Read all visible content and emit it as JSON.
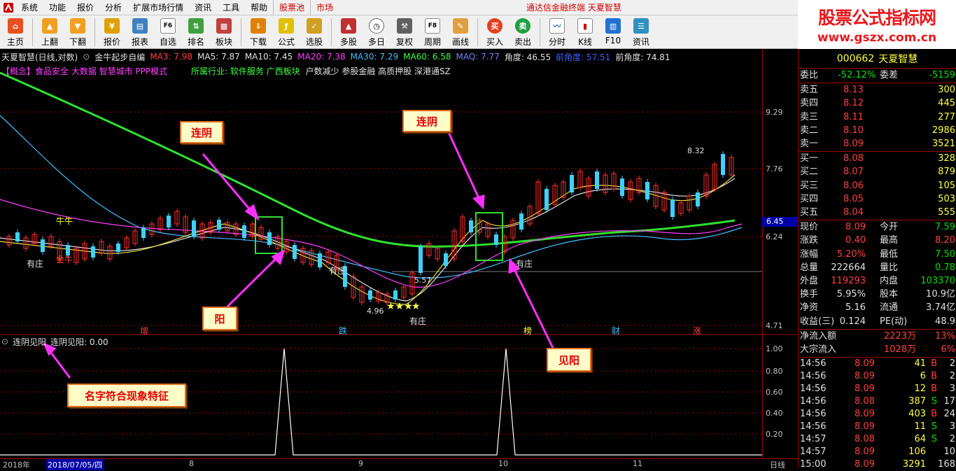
{
  "menubar": {
    "items": [
      "系统",
      "功能",
      "报价",
      "分析",
      "扩展市场行情",
      "资讯",
      "工具",
      "帮助"
    ],
    "tabs": [
      "股票池",
      "市场"
    ],
    "center_title": "通达信金融终端  天夏智慧"
  },
  "toolbar": {
    "buttons": [
      {
        "label": "主页",
        "icon": "home-icon"
      },
      {
        "label": "上翻",
        "icon": "page-up-icon"
      },
      {
        "label": "下翻",
        "icon": "page-down-icon"
      },
      {
        "label": "报价",
        "icon": "quote-icon"
      },
      {
        "label": "报表",
        "icon": "report-icon"
      },
      {
        "label": "自选",
        "icon": "favorites-icon"
      },
      {
        "label": "排名",
        "icon": "ranking-icon"
      },
      {
        "label": "板块",
        "icon": "sector-icon"
      },
      {
        "label": "下载",
        "icon": "download-icon"
      },
      {
        "label": "公式",
        "icon": "formula-icon"
      },
      {
        "label": "选股",
        "icon": "stock-select-icon"
      },
      {
        "label": "多股",
        "icon": "multi-stock-icon"
      },
      {
        "label": "多日",
        "icon": "multi-day-icon"
      },
      {
        "label": "复权",
        "icon": "adjust-icon"
      },
      {
        "label": "周期",
        "icon": "period-icon"
      },
      {
        "label": "画线",
        "icon": "draw-line-icon"
      },
      {
        "label": "买入",
        "icon": "buy-icon"
      },
      {
        "label": "卖出",
        "icon": "sell-icon"
      },
      {
        "label": "分时",
        "icon": "intraday-icon"
      },
      {
        "label": "K线",
        "icon": "kline-icon"
      },
      {
        "label": "F10",
        "icon": "f10-icon"
      },
      {
        "label": "资讯",
        "icon": "news-icon"
      }
    ],
    "icon_texts": {
      "auto": "F6",
      "period": "F8",
      "buy": "买",
      "sell": "卖"
    }
  },
  "brand": {
    "title": "股票公式指标网",
    "url": "www.gszx.com.cn"
  },
  "chart_header": {
    "name": "天夏智慧(日线,对数)",
    "indicator": "金牛起步自编",
    "ma": [
      {
        "label": "MA3: 7.98",
        "color": "#ff4040"
      },
      {
        "label": "MA5: 7.87",
        "color": "#e0e0e0"
      },
      {
        "label": "MA10: 7.45",
        "color": "#e0e0e0"
      },
      {
        "label": "MA20: 7.38",
        "color": "#ff40ff"
      },
      {
        "label": "MA30: 7.29",
        "color": "#40c0ff"
      },
      {
        "label": "MA60: 6.58",
        "color": "#40ff40"
      },
      {
        "label": "MAQ: 7.77",
        "color": "#8080ff"
      },
      {
        "label": "角度: 46.55",
        "color": "#e0e0e0"
      },
      {
        "label": "前角度: 57.51",
        "color": "#4060ff"
      },
      {
        "label": "前角度: 74.81",
        "color": "#e0e0e0"
      }
    ],
    "concept": "【概念】食品安全 大数据 智慧城市 PPP模式",
    "industry": "所属行业: 软件服务  广西板块",
    "tags": "户数减少 参股金融 高质押股 深港通SZ"
  },
  "price_axis": {
    "ticks": [
      "9.29",
      "7.76",
      "6.24",
      "4.71"
    ],
    "current_box": "6.45"
  },
  "chart_labels": {
    "niu": "牛牛",
    "jinniu": "金牛",
    "youzhuang": "有庄",
    "high": "8.32",
    "low": "4.96",
    "mid": "5.57",
    "note_bottom": [
      "增",
      "跌",
      "榜",
      "财",
      "涨"
    ]
  },
  "indicator_panel": {
    "name": "连阴见阳",
    "value_label": "连阴见阳: 0.00",
    "ticks": [
      "1.00",
      "0.80",
      "0.60",
      "0.40",
      "0.20"
    ]
  },
  "annotations": {
    "a1": "连阴",
    "a2": "连阴",
    "a3": "阳",
    "a4": "见阳",
    "a5": "名字符合现象特征"
  },
  "date_bar": {
    "labels": [
      "2018年",
      "2018/07/05/四",
      "8",
      "9",
      "10",
      "11",
      "日线"
    ]
  },
  "quote": {
    "code": "000662",
    "name": "天夏智慧",
    "weibi": {
      "label": "委比",
      "value": "-52.12%",
      "label2": "委差",
      "value2": "-5159"
    },
    "sells": [
      {
        "label": "卖五",
        "price": "8.13",
        "vol": "300"
      },
      {
        "label": "卖四",
        "price": "8.12",
        "vol": "445"
      },
      {
        "label": "卖三",
        "price": "8.11",
        "vol": "277"
      },
      {
        "label": "卖二",
        "price": "8.10",
        "vol": "2986"
      },
      {
        "label": "卖一",
        "price": "8.09",
        "vol": "3521"
      }
    ],
    "buys": [
      {
        "label": "买一",
        "price": "8.08",
        "vol": "328"
      },
      {
        "label": "买二",
        "price": "8.07",
        "vol": "879"
      },
      {
        "label": "买三",
        "price": "8.06",
        "vol": "105"
      },
      {
        "label": "买四",
        "price": "8.05",
        "vol": "503"
      },
      {
        "label": "买五",
        "price": "8.04",
        "vol": "555"
      }
    ],
    "stats": [
      {
        "l1": "现价",
        "v1": "8.09",
        "l2": "今开",
        "v2": "7.59",
        "c1": "rd",
        "c2": "gr"
      },
      {
        "l1": "涨跌",
        "v1": "0.40",
        "l2": "最高",
        "v2": "8.20",
        "c1": "rd",
        "c2": "rd"
      },
      {
        "l1": "涨幅",
        "v1": "5.20%",
        "l2": "最低",
        "v2": "7.50",
        "c1": "rd",
        "c2": "gr"
      },
      {
        "l1": "总量",
        "v1": "222664",
        "l2": "量比",
        "v2": "0.78",
        "c1": "wh",
        "c2": "gr"
      },
      {
        "l1": "外盘",
        "v1": "119293",
        "l2": "内盘",
        "v2": "103370",
        "c1": "rd",
        "c2": "gr"
      },
      {
        "l1": "换手",
        "v1": "5.95%",
        "l2": "股本",
        "v2": "10.9亿",
        "c1": "wh",
        "c2": "wh"
      },
      {
        "l1": "净资",
        "v1": "5.16",
        "l2": "流通",
        "v2": "3.74亿",
        "c1": "wh",
        "c2": "wh"
      },
      {
        "l1": "收益(三)",
        "v1": "0.124",
        "l2": "PE(动)",
        "v2": "48.9",
        "c1": "wh",
        "c2": "wh"
      }
    ],
    "flows": [
      {
        "l": "净流入额",
        "v1": "2223万",
        "v2": "13%"
      },
      {
        "l": "大宗流入",
        "v1": "1028万",
        "v2": "6%"
      }
    ],
    "ticks": [
      {
        "t": "14:56",
        "p": "8.09",
        "v": "41",
        "s": "B",
        "n": "2"
      },
      {
        "t": "14:56",
        "p": "8.09",
        "v": "6",
        "s": "B",
        "n": "2"
      },
      {
        "t": "14:56",
        "p": "8.09",
        "v": "12",
        "s": "B",
        "n": "3"
      },
      {
        "t": "14:56",
        "p": "8.08",
        "v": "387",
        "s": "S",
        "n": "17"
      },
      {
        "t": "14:56",
        "p": "8.09",
        "v": "403",
        "s": "B",
        "n": "24"
      },
      {
        "t": "14:56",
        "p": "8.09",
        "v": "11",
        "s": "S",
        "n": "3"
      },
      {
        "t": "14:57",
        "p": "8.08",
        "v": "64",
        "s": "S",
        "n": "2"
      },
      {
        "t": "14:57",
        "p": "8.09",
        "v": "106",
        "s": "",
        "n": "10"
      },
      {
        "t": "15:00",
        "p": "8.09",
        "v": "3291",
        "s": "",
        "n": "168"
      }
    ]
  }
}
